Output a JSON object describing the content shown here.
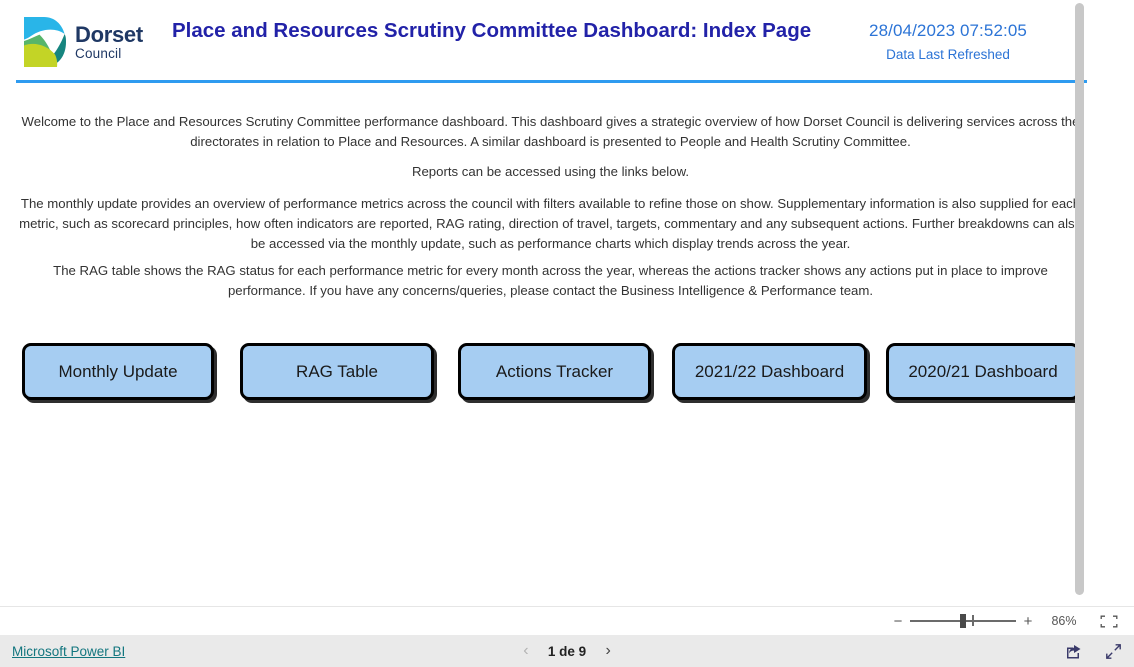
{
  "header": {
    "logo": {
      "name": "Dorset",
      "subtitle": "Council",
      "colors": {
        "cyan": "#29b5e8",
        "teal": "#16857f",
        "green": "#57b56a",
        "lime": "#c3d426",
        "wordmark": "#1f3864"
      }
    },
    "title": "Place and Resources Scrutiny Committee Dashboard: Index Page",
    "refresh_time": "28/04/2023 07:52:05",
    "refresh_label": "Data Last Refreshed",
    "rule_color": "#2e9bf0"
  },
  "body": {
    "paragraph_1": "Welcome to the Place and Resources Scrutiny Committee performance dashboard. This dashboard gives a strategic overview of how Dorset Council is delivering services across the directorates in relation to Place and Resources. A similar dashboard is presented to People and Health Scrutiny Committee.",
    "paragraph_2": "Reports can be accessed using the links below.",
    "paragraph_3": "The monthly update provides an overview of performance metrics across the council with filters available to refine those on show. Supplementary information is also supplied for each metric, such as scorecard principles, how often indicators are reported, RAG rating, direction of travel, targets, commentary and any subsequent actions. Further breakdowns can also be accessed via the monthly update, such as performance charts which display trends across the year.",
    "paragraph_4": "The RAG table shows the RAG status for each performance metric for every month across the year, whereas the actions tracker shows any actions put in place to improve performance. If you have any concerns/queries, please contact the Business Intelligence & Performance team."
  },
  "buttons": {
    "fill_color": "#a6cdf2",
    "items": [
      {
        "label": "Monthly Update"
      },
      {
        "label": "RAG Table"
      },
      {
        "label": "Actions Tracker"
      },
      {
        "label": "2021/22 Dashboard"
      },
      {
        "label": "2020/21 Dashboard"
      }
    ]
  },
  "zoom_bar": {
    "minus_label": "−",
    "plus_label": "+",
    "zoom_value": "86%",
    "fit_icon": "fit-to-page-icon"
  },
  "status_bar": {
    "powerbi_label": "Microsoft Power BI",
    "pager": {
      "prev_icon": "‹",
      "label": "1 de 9",
      "next_icon": "›"
    },
    "share_icon": "share-icon",
    "fullscreen_icon": "fullscreen-icon"
  }
}
